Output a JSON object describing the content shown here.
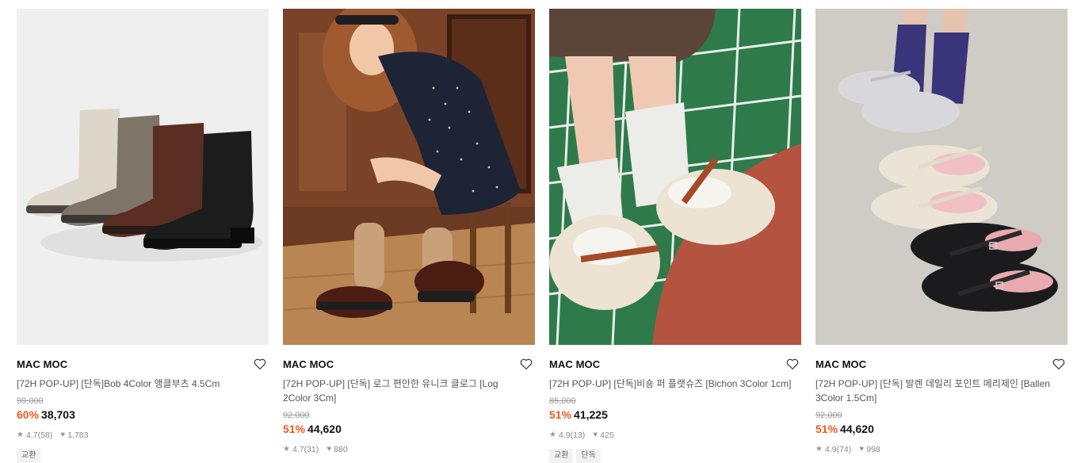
{
  "products": [
    {
      "brand": "MAC MOC",
      "title": "[72H POP-UP] [단독]Bob 4Color 앵클부츠 4.5Cm",
      "original_price": "99,000",
      "discount": "60%",
      "price": "38,703",
      "rating": "4.7",
      "reviews": "(58)",
      "likes": "1,783",
      "tags": [
        "교환"
      ]
    },
    {
      "brand": "MAC MOC",
      "title": "[72H POP-UP] [단독] 로그 편안한 유니크 클로그 [Log 2Color 3Cm]",
      "original_price": "92,000",
      "discount": "51%",
      "price": "44,620",
      "rating": "4.7",
      "reviews": "(31)",
      "likes": "880",
      "tags": []
    },
    {
      "brand": "MAC MOC",
      "title": "[72H POP-UP] [단독]비숑 퍼 플랫슈즈 [Bichon 3Color 1cm]",
      "original_price": "85,000",
      "discount": "51%",
      "price": "41,225",
      "rating": "4.9",
      "reviews": "(13)",
      "likes": "425",
      "tags": [
        "교환",
        "단독"
      ]
    },
    {
      "brand": "MAC MOC",
      "title": "[72H POP-UP] [단독] 발렌 데일리 포인트 메리제인 [Ballen 3Color 1.5Cm]",
      "original_price": "92,000",
      "discount": "51%",
      "price": "44,620",
      "rating": "4.9",
      "reviews": "(74)",
      "likes": "998",
      "tags": []
    }
  ],
  "icons": {
    "wishlist": "heart-outline-icon",
    "rating": "star-icon",
    "likes": "heart-filled-icon"
  },
  "colors": {
    "discount": "#f05a22",
    "price": "#111111",
    "meta": "#888888"
  }
}
